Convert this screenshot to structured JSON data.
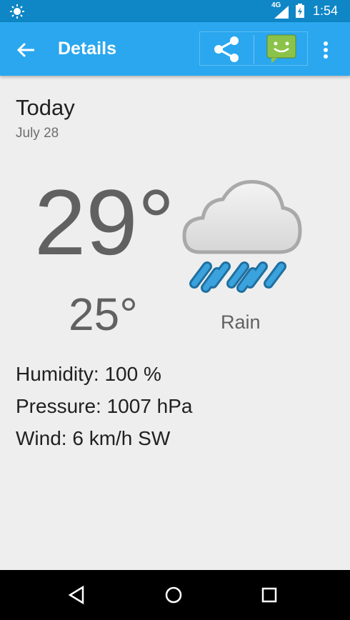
{
  "status_bar": {
    "network_label": "4G",
    "time": "1:54",
    "icons": [
      "weather-notification-icon",
      "signal-icon",
      "battery-icon"
    ]
  },
  "app_bar": {
    "title": "Details",
    "back_icon": "arrow-back-icon",
    "share_icon": "share-icon",
    "message_icon": "message-app-icon",
    "overflow_icon": "more-vert-icon",
    "color": "#2aa7ee"
  },
  "forecast": {
    "day": "Today",
    "date": "July 28",
    "high": "29°",
    "low": "25°",
    "condition": "Rain",
    "icon": "rain-cloud-icon",
    "humidity": "Humidity: 100 %",
    "pressure": "Pressure: 1007 hPa",
    "wind": "Wind: 6 km/h SW"
  },
  "nav_bar": {
    "icons": [
      "nav-back-icon",
      "nav-home-icon",
      "nav-recents-icon"
    ]
  },
  "colors": {
    "status_bar": "#0f86c6",
    "app_bar": "#2aa7ee",
    "background": "#eeeeee"
  }
}
